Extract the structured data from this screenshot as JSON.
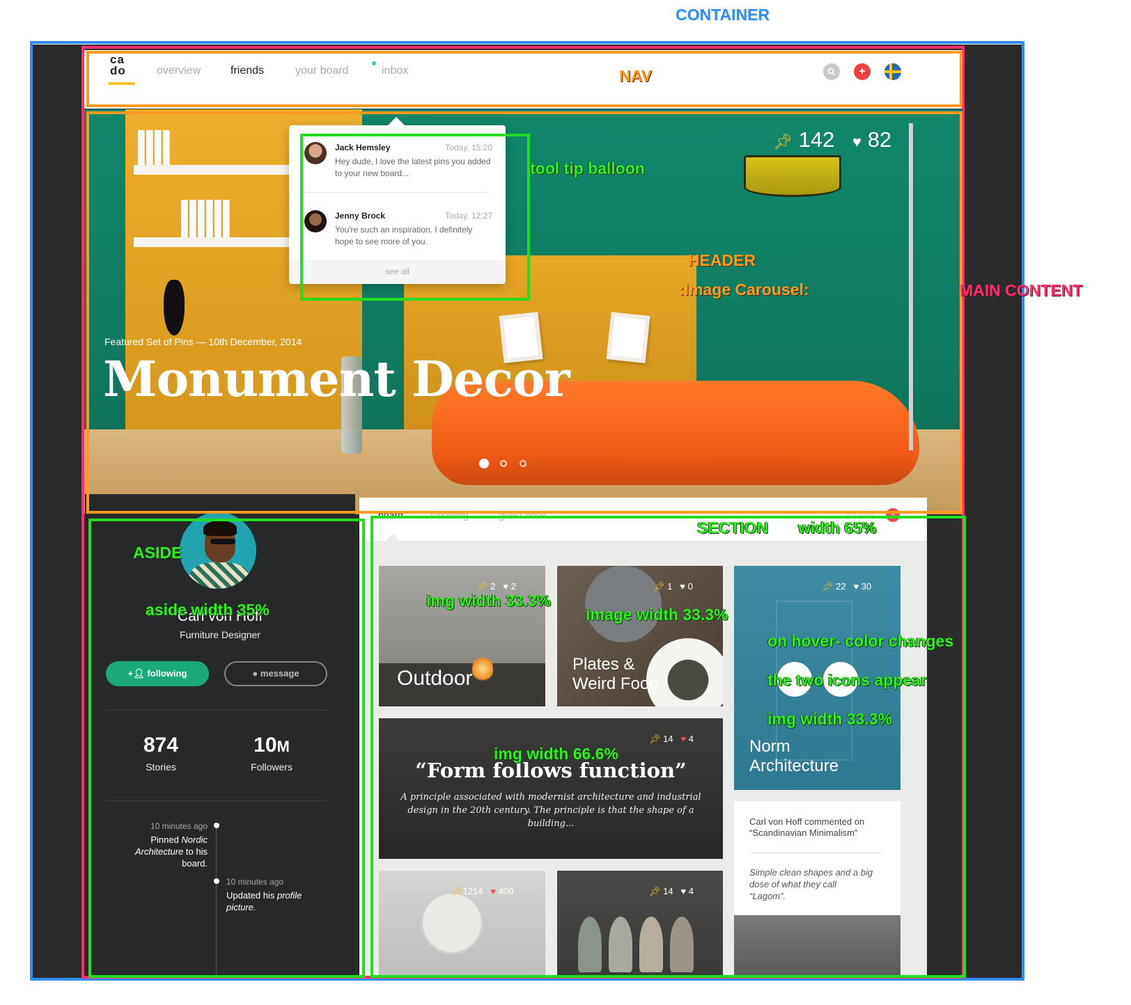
{
  "annotations": {
    "container": "CONTAINER",
    "nav": "NAV",
    "header": "HEADER",
    "carousel": ":Image Carousel:",
    "main_content": "MAIN CONTENT",
    "tooltip": "tool tip balloon",
    "aside": "ASIDE",
    "aside_width": "aside width 35%",
    "section": "SECTION",
    "section_width": "width 65%",
    "img_width_1": "img width 33.3%",
    "img_width_2": "image width 33.3%",
    "hover_1": "on hover- color changes",
    "hover_2": "the two icons appear",
    "img_width_3": "img width 33.3%",
    "img_width_4": "img width 66.6%"
  },
  "nav": {
    "logo_top": "ca",
    "logo_bottom": "do",
    "links": [
      {
        "label": "overview",
        "active": false
      },
      {
        "label": "friends",
        "active": true
      },
      {
        "label": "your board",
        "active": false
      },
      {
        "label": "inbox",
        "active": false
      }
    ],
    "icons": [
      "search-icon",
      "add-icon",
      "flag-icon"
    ]
  },
  "header": {
    "pins": "142",
    "likes": "82",
    "featured": "Featured Set of Pins — 10th December, 2014",
    "title": "Monument Decor",
    "slides": 3,
    "active_slide": 1
  },
  "tooltip": {
    "messages": [
      {
        "name": "Jack Hemsley",
        "time": "Today, 15:20",
        "text": "Hey dude, I love the latest pins you added to your new board..."
      },
      {
        "name": "Jenny Brock",
        "time": "Today, 12:27",
        "text": "You're such an inspiration. I definitely hope to see more of you."
      }
    ],
    "see_all": "see all"
  },
  "aside": {
    "name": "Carl von Hoff",
    "role": "Furniture Designer",
    "follow_label": "following",
    "message_label": "message",
    "stories_value": "874",
    "stories_label": "Stories",
    "followers_value": "10",
    "followers_unit": "M",
    "followers_label": "Followers",
    "timeline": [
      {
        "time": "10 minutes ago",
        "pre": "Pinned ",
        "italic": "Nordic Architecture",
        "post": " to his board."
      },
      {
        "time": "10 minutes ago",
        "pre": "Updated his ",
        "italic": "profile picture.",
        "post": ""
      }
    ]
  },
  "section": {
    "tabs": [
      {
        "label": "board",
        "active": true
      },
      {
        "label": "following",
        "active": false
      },
      {
        "label": "guest book",
        "active": false
      },
      {
        "label": "invites",
        "active": false
      }
    ],
    "invites_count": "8",
    "cards": {
      "outdoor": {
        "title": "Outdoor",
        "pins": "2",
        "likes": "2"
      },
      "plates": {
        "title_1": "Plates &",
        "title_2": "Weird Food",
        "pins": "1",
        "likes": "0"
      },
      "norm": {
        "title_1": "Norm",
        "title_2": "Architecture",
        "pins": "22",
        "likes": "30"
      },
      "quote": {
        "title": "“Form follows function”",
        "body": "A principle associated with modernist architecture and industrial design in the 20th century. The principle is that the shape of a building...",
        "pins": "14",
        "likes": "4"
      },
      "clock": {
        "pins": "1214",
        "likes": "400"
      },
      "hooks": {
        "pins": "14",
        "likes": "4"
      }
    },
    "comment": {
      "header": "Carl von Hoff commented on",
      "board": "“Scandinavian Minimalism”",
      "text": "Simple clean shapes and a big dose of what they call “Lagom”."
    }
  },
  "colors": {
    "accent_green": "#1ba97a",
    "badge_red": "#ef4b4b",
    "logo_yellow": "#f5c12a",
    "container_blue": "#2f8df5",
    "main_pink": "#ff2f6e",
    "nav_orange": "#ff9920",
    "annotation_green": "#22dd22"
  }
}
